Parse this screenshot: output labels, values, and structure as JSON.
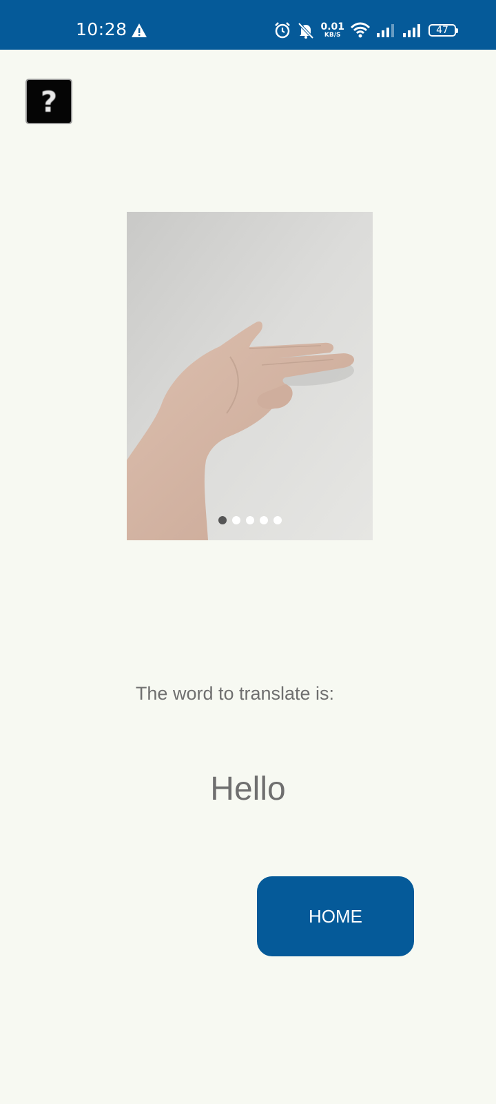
{
  "status_bar": {
    "time": "10:28",
    "network_speed_value": "0.01",
    "network_speed_unit": "KB/S",
    "battery": "47",
    "icons": [
      "warning-icon",
      "alarm-icon",
      "bell-muted-icon",
      "wifi-icon",
      "signal-icon",
      "signal-icon"
    ]
  },
  "help": {
    "label": "?"
  },
  "carousel": {
    "slide_count": 5,
    "active_index": 0
  },
  "main": {
    "prompt": "The word to translate is:",
    "word": "Hello",
    "home_button": "HOME"
  },
  "colors": {
    "primary": "#055a99",
    "background": "#f7f9f2",
    "text": "#6f6f6f"
  }
}
